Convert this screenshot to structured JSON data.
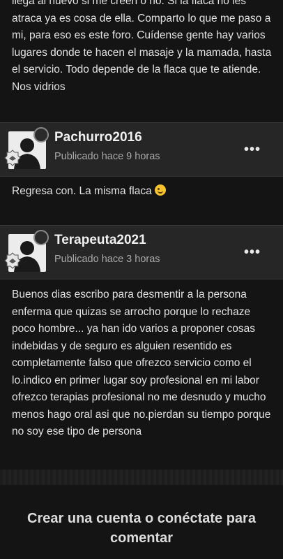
{
  "top_post": {
    "text": "llega al nuevo si me creen o no. Si la flaca no les atraca ya es cosa de ella. Comparto lo que me paso a mi, para eso es este foro. Cuídense gente hay varios lugares donde te hacen el masaje y la mamada, hasta el servicio. Todo depende de la flaca que te atiende. Nos vidrios"
  },
  "posts": [
    {
      "username": "Pachurro2016",
      "posted": "Publicado hace 9 horas",
      "menu": "•••",
      "text": "Regresa con. La misma flaca"
    },
    {
      "username": "Terapeuta2021",
      "posted": "Publicado hace 3 horas",
      "menu": "•••",
      "text": "Buenos dias escribo para desmentir a la persona enferma que quizas se arrocho porque lo rechaze poco hombre... ya han ido varios a proponer cosas indebidas y de seguro es alguien resentido es completamente falso que ofrezco servicio como el lo.indico en primer lugar soy profesional en mi labor ofrezco terapias profesional no me desnudo y mucho menos hago oral asi que no.pierdan su tiempo porque no soy ese tipo de persona"
    }
  ],
  "cta": {
    "label": "Crear una cuenta o conéctate para comentar"
  },
  "colors": {
    "background": "#141414",
    "header": "#262626",
    "text": "#e2e2e2"
  },
  "icons": [
    "default-avatar-icon",
    "online-status-icon",
    "rank-badge-icon",
    "more-options-icon",
    "wink-emoji-icon"
  ]
}
